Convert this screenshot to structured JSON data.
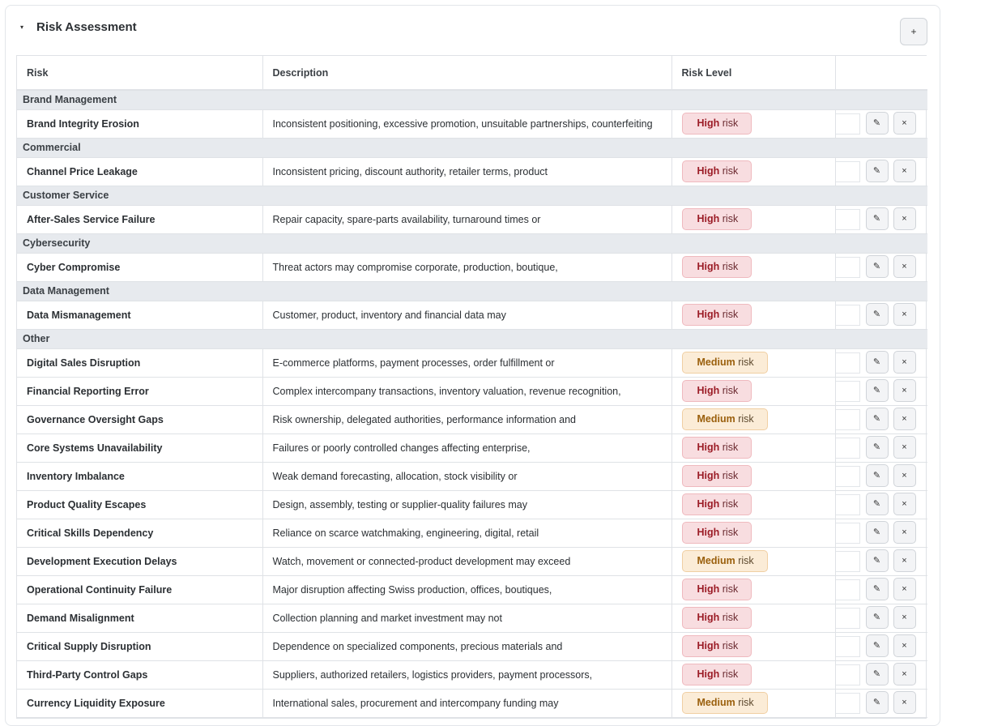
{
  "section": {
    "title": "Risk Assessment",
    "caret_icon": "caret-down-icon",
    "add_label": "+"
  },
  "table": {
    "columns": [
      "Risk",
      "Description",
      "Risk Level",
      ""
    ],
    "action_labels": {
      "edit": "✎",
      "delete": "×"
    },
    "groups": [
      {
        "name": "Brand Management",
        "rows": [
          {
            "risk": "Brand Integrity Erosion",
            "description": "Inconsistent positioning, excessive promotion, unsuitable partnerships, counterfeiting",
            "level": "High",
            "suffix": "risk"
          }
        ]
      },
      {
        "name": "Commercial",
        "rows": [
          {
            "risk": "Channel Price Leakage",
            "description": "Inconsistent pricing, discount authority, retailer terms, product",
            "level": "High",
            "suffix": "risk"
          }
        ]
      },
      {
        "name": "Customer Service",
        "rows": [
          {
            "risk": "After-Sales Service Failure",
            "description": "Repair capacity, spare-parts availability, turnaround times or",
            "level": "High",
            "suffix": "risk"
          }
        ]
      },
      {
        "name": "Cybersecurity",
        "rows": [
          {
            "risk": "Cyber Compromise",
            "description": "Threat actors may compromise corporate, production, boutique,",
            "level": "High",
            "suffix": "risk"
          }
        ]
      },
      {
        "name": "Data Management",
        "rows": [
          {
            "risk": "Data Mismanagement",
            "description": "Customer, product, inventory and financial data may",
            "level": "High",
            "suffix": "risk"
          }
        ]
      },
      {
        "name": "Other",
        "rows": [
          {
            "risk": "Digital Sales Disruption",
            "description": "E-commerce platforms, payment processes, order fulfillment or",
            "level": "Medium",
            "suffix": "risk"
          },
          {
            "risk": "Financial Reporting Error",
            "description": "Complex intercompany transactions, inventory valuation, revenue recognition,",
            "level": "High",
            "suffix": "risk"
          },
          {
            "risk": "Governance Oversight Gaps",
            "description": "Risk ownership, delegated authorities, performance information and",
            "level": "Medium",
            "suffix": "risk"
          },
          {
            "risk": "Core Systems Unavailability",
            "description": "Failures or poorly controlled changes affecting enterprise,",
            "level": "High",
            "suffix": "risk"
          },
          {
            "risk": "Inventory Imbalance",
            "description": "Weak demand forecasting, allocation, stock visibility or",
            "level": "High",
            "suffix": "risk"
          },
          {
            "risk": "Product Quality Escapes",
            "description": "Design, assembly, testing or supplier-quality failures may",
            "level": "High",
            "suffix": "risk"
          },
          {
            "risk": "Critical Skills Dependency",
            "description": "Reliance on scarce watchmaking, engineering, digital, retail",
            "level": "High",
            "suffix": "risk"
          },
          {
            "risk": "Development Execution Delays",
            "description": "Watch, movement or connected-product development may exceed",
            "level": "Medium",
            "suffix": "risk"
          },
          {
            "risk": "Operational Continuity Failure",
            "description": "Major disruption affecting Swiss production, offices, boutiques,",
            "level": "High",
            "suffix": "risk"
          },
          {
            "risk": "Demand Misalignment",
            "description": "Collection planning and market investment may not",
            "level": "High",
            "suffix": "risk"
          },
          {
            "risk": "Critical Supply Disruption",
            "description": "Dependence on specialized components, precious materials and",
            "level": "High",
            "suffix": "risk"
          },
          {
            "risk": "Third-Party Control Gaps",
            "description": "Suppliers, authorized retailers, logistics providers, payment processors,",
            "level": "High",
            "suffix": "risk"
          },
          {
            "risk": "Currency Liquidity Exposure",
            "description": "International sales, procurement and intercompany funding may",
            "level": "Medium",
            "suffix": "risk"
          }
        ]
      }
    ]
  },
  "colors": {
    "high_bg": "#f8dde0",
    "high_text": "#9b1c26",
    "medium_bg": "#fbecd7",
    "medium_text": "#9a5f0c",
    "group_bg": "#e7eaee"
  }
}
